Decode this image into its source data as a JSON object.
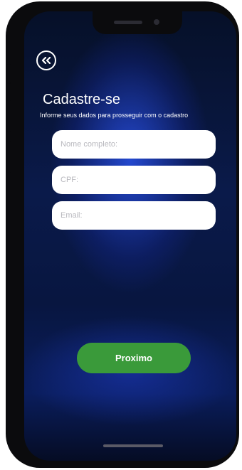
{
  "header": {
    "back_icon": "double-chevron-left-icon",
    "title": "Cadastre-se",
    "subtitle": "Informe seus dados para prosseguir com o cadastro"
  },
  "form": {
    "fields": [
      {
        "placeholder": "Nome completo:",
        "value": ""
      },
      {
        "placeholder": "CPF:",
        "value": ""
      },
      {
        "placeholder": "Email:",
        "value": ""
      }
    ],
    "submit_label": "Proximo"
  },
  "colors": {
    "accent_button": "#3a9a3a",
    "background": "#0a1a4a",
    "field_background": "#ffffff"
  }
}
